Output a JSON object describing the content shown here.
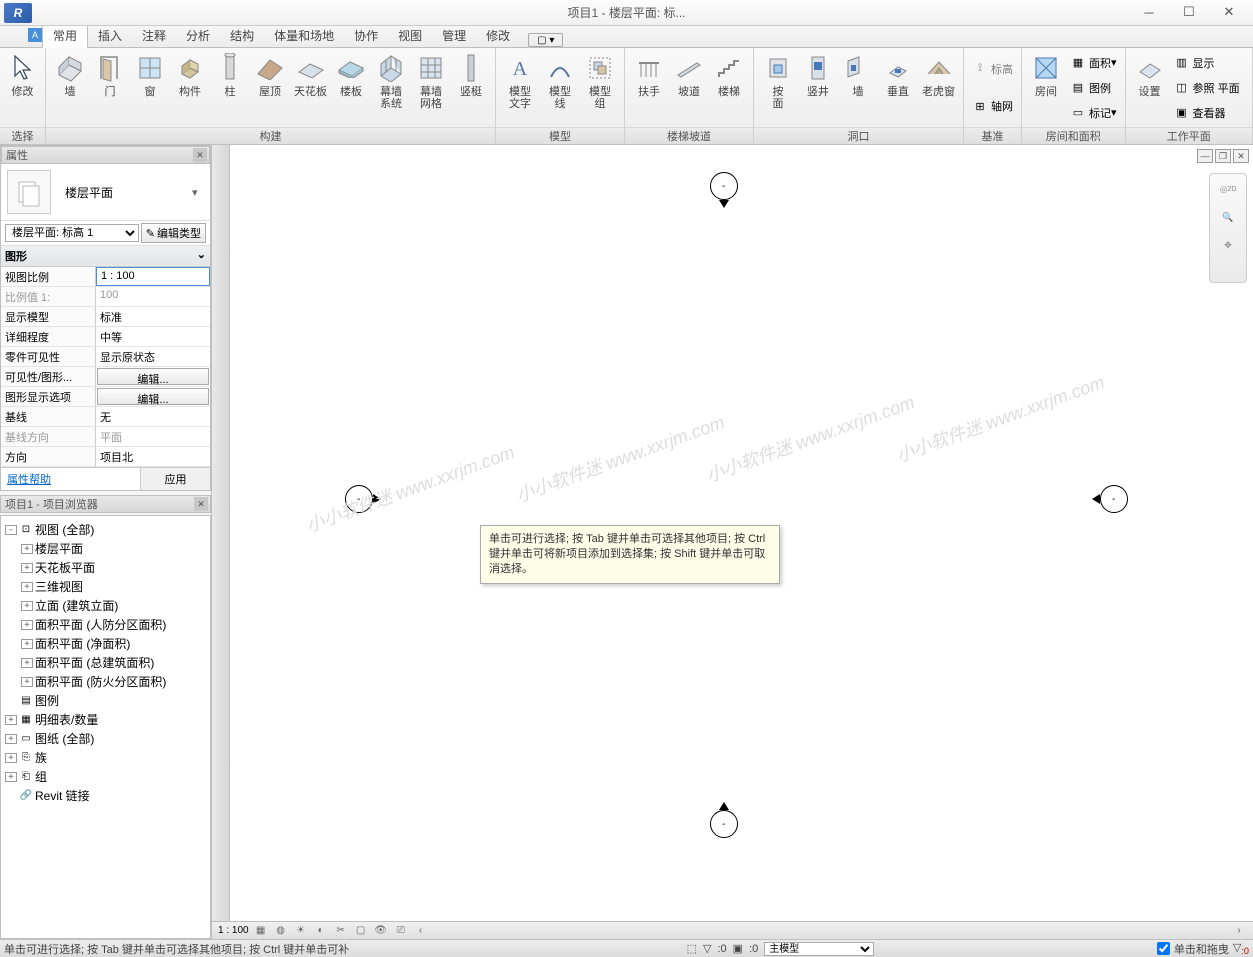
{
  "title": "项目1 - 楼层平面: 标...",
  "app_letter": "R",
  "badge": "A",
  "tabs": [
    "常用",
    "插入",
    "注释",
    "分析",
    "结构",
    "体量和场地",
    "协作",
    "视图",
    "管理",
    "修改"
  ],
  "tab_extra": "▢ ▾",
  "ribbon": {
    "select": {
      "modify": "修改",
      "group": "选择"
    },
    "build": {
      "wall": "墙",
      "door": "门",
      "window": "窗",
      "component": "构件",
      "column": "柱",
      "roof": "屋顶",
      "ceiling": "天花板",
      "floor": "楼板",
      "curtain_sys": "幕墙\n系统",
      "curtain_grid": "幕墙\n网格",
      "mullion": "竖梃",
      "group": "构建"
    },
    "model": {
      "text": "模型\n文字",
      "line": "模型\n线",
      "group_btn": "模型\n组",
      "group": "模型"
    },
    "stair": {
      "railing": "扶手",
      "ramp": "坡道",
      "stair": "楼梯",
      "group": "楼梯坡道"
    },
    "opening": {
      "byface": "按\n面",
      "shaft": "竖井",
      "wall": "墙",
      "vertical": "垂直",
      "dormer": "老虎窗",
      "group": "洞口"
    },
    "datum": {
      "level": "标高",
      "grid": "轴网",
      "group": "基准"
    },
    "room": {
      "room": "房间",
      "area": "面积",
      "legend": "图例",
      "tag": "标记",
      "group": "房间和面积"
    },
    "work": {
      "set": "设置",
      "show": "显示",
      "ref": "参照 平面",
      "viewer": "查看器",
      "group": "工作平面"
    }
  },
  "properties": {
    "title": "属性",
    "type_name": "楼层平面",
    "instance": "楼层平面: 标高 1",
    "edit_type": "编辑类型",
    "section": "图形",
    "rows": [
      {
        "n": "视图比例",
        "v": "1 : 100",
        "sel": true
      },
      {
        "n": "比例值 1:",
        "v": "100",
        "dis": true
      },
      {
        "n": "显示模型",
        "v": "标准"
      },
      {
        "n": "详细程度",
        "v": "中等"
      },
      {
        "n": "零件可见性",
        "v": "显示原状态"
      },
      {
        "n": "可见性/图形...",
        "v": "编辑...",
        "btn": true
      },
      {
        "n": "图形显示选项",
        "v": "编辑...",
        "btn": true
      },
      {
        "n": "基线",
        "v": "无"
      },
      {
        "n": "基线方向",
        "v": "平面",
        "dis": true
      },
      {
        "n": "方向",
        "v": "项目北"
      }
    ],
    "help": "属性帮助",
    "apply": "应用"
  },
  "browser": {
    "title": "项目1 - 项目浏览器",
    "items": [
      {
        "d": 0,
        "tw": "-",
        "icon": "views",
        "label": "视图 (全部)"
      },
      {
        "d": 1,
        "tw": "+",
        "label": "楼层平面"
      },
      {
        "d": 1,
        "tw": "+",
        "label": "天花板平面"
      },
      {
        "d": 1,
        "tw": "+",
        "label": "三维视图"
      },
      {
        "d": 1,
        "tw": "+",
        "label": "立面 (建筑立面)"
      },
      {
        "d": 1,
        "tw": "+",
        "label": "面积平面 (人防分区面积)"
      },
      {
        "d": 1,
        "tw": "+",
        "label": "面积平面 (净面积)"
      },
      {
        "d": 1,
        "tw": "+",
        "label": "面积平面 (总建筑面积)"
      },
      {
        "d": 1,
        "tw": "+",
        "label": "面积平面 (防火分区面积)"
      },
      {
        "d": 0,
        "tw": "",
        "icon": "legend",
        "label": "图例"
      },
      {
        "d": 0,
        "tw": "+",
        "icon": "sched",
        "label": "明细表/数量"
      },
      {
        "d": 0,
        "tw": "+",
        "icon": "sheet",
        "label": "图纸 (全部)"
      },
      {
        "d": 0,
        "tw": "+",
        "icon": "fam",
        "label": "族"
      },
      {
        "d": 0,
        "tw": "+",
        "icon": "grp",
        "label": "组"
      },
      {
        "d": 0,
        "tw": "",
        "icon": "link",
        "label": "Revit 链接"
      }
    ]
  },
  "tooltip": "单击可进行选择; 按 Tab 键并单击可选择其他项目; 按 Ctrl 键并单击可将新项目添加到选择集; 按 Shift 键并单击可取消选择。",
  "viewbar": {
    "scale": "1 : 100"
  },
  "status": {
    "text": "单击可进行选择; 按 Tab 键并单击可选择其他项目; 按 Ctrl 键并单击可补",
    "sel0": ":0",
    "sel1": ":0",
    "model": "主模型",
    "drag": "单击和拖曳"
  },
  "watermarks": [
    "小小软件迷 www.xxrjm.com",
    "小小软件迷 www.xxrjm.com",
    "小小软件迷 www.xxrjm.com",
    "小小软件迷 www.xxrjm.com"
  ]
}
